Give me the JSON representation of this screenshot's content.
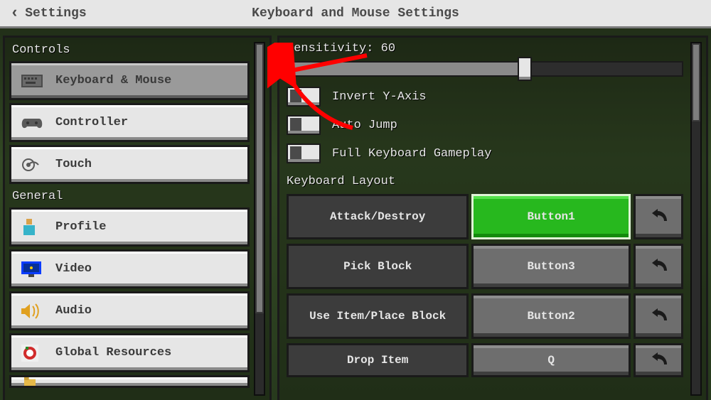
{
  "topbar": {
    "back_label": "Settings",
    "title": "Keyboard and Mouse Settings"
  },
  "sidebar": {
    "sections": [
      {
        "heading": "Controls",
        "items": [
          {
            "id": "keyboard-mouse",
            "label": "Keyboard & Mouse",
            "icon": "keyboard-icon",
            "active": true
          },
          {
            "id": "controller",
            "label": "Controller",
            "icon": "controller-icon",
            "active": false
          },
          {
            "id": "touch",
            "label": "Touch",
            "icon": "touch-icon",
            "active": false
          }
        ]
      },
      {
        "heading": "General",
        "items": [
          {
            "id": "profile",
            "label": "Profile",
            "icon": "profile-icon"
          },
          {
            "id": "video",
            "label": "Video",
            "icon": "video-icon"
          },
          {
            "id": "audio",
            "label": "Audio",
            "icon": "audio-icon"
          },
          {
            "id": "global-resources",
            "label": "Global Resources",
            "icon": "global-resources-icon"
          }
        ]
      }
    ]
  },
  "settings": {
    "sensitivity_label": "Sensitivity: 60",
    "sensitivity_value": 60,
    "toggles": [
      {
        "id": "invert-y",
        "label": "Invert Y-Axis",
        "on": false
      },
      {
        "id": "auto-jump",
        "label": "Auto Jump",
        "on": false
      },
      {
        "id": "full-kb",
        "label": "Full Keyboard Gameplay",
        "on": false
      }
    ],
    "keybind_heading": "Keyboard Layout",
    "keybinds": [
      {
        "action": "Attack/Destroy",
        "binding": "Button1",
        "selected": true
      },
      {
        "action": "Pick Block",
        "binding": "Button3",
        "selected": false
      },
      {
        "action": "Use Item/Place Block",
        "binding": "Button2",
        "selected": false
      },
      {
        "action": "Drop Item",
        "binding": "Q",
        "selected": false
      }
    ]
  },
  "annotation": {
    "type": "red-arrow",
    "points_to": "sidebar-item-keyboard-mouse"
  }
}
